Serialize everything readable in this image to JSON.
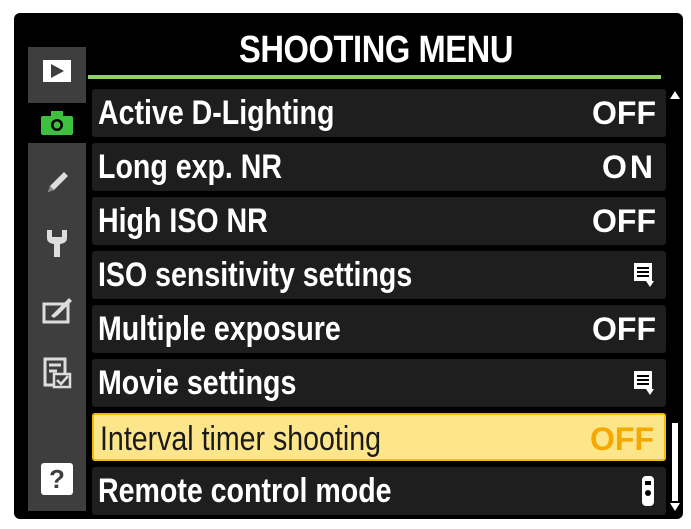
{
  "menu": {
    "title": "SHOOTING MENU"
  },
  "sidebar": {
    "items": [
      {
        "icon": "playback-icon",
        "active": false
      },
      {
        "icon": "camera-icon",
        "active": true
      },
      {
        "icon": "pencil-icon",
        "active": false
      },
      {
        "icon": "wrench-icon",
        "active": false
      },
      {
        "icon": "retouch-brush-icon",
        "active": false
      },
      {
        "icon": "recent-settings-icon",
        "active": false
      },
      {
        "icon": "help-icon",
        "active": false
      }
    ],
    "help_label": "?"
  },
  "rows": [
    {
      "label": "Active D-Lighting",
      "value": "OFF"
    },
    {
      "label": "Long exp. NR",
      "value": "ON"
    },
    {
      "label": "High ISO NR",
      "value": "OFF"
    },
    {
      "label": "ISO sensitivity settings",
      "value": "",
      "value_icon": "submenu-icon"
    },
    {
      "label": "Multiple exposure",
      "value": "OFF"
    },
    {
      "label": "Movie settings",
      "value": "",
      "value_icon": "submenu-icon"
    },
    {
      "label": "Interval timer shooting",
      "value": "OFF",
      "selected": true
    },
    {
      "label": "Remote control mode",
      "value": "",
      "value_icon": "remote-icon"
    }
  ],
  "colors": {
    "accent_line": "#8fd06a",
    "selected_bg": "#fde68a",
    "selected_value": "#f5a800",
    "active_tab_icon": "#3fbf3f"
  }
}
